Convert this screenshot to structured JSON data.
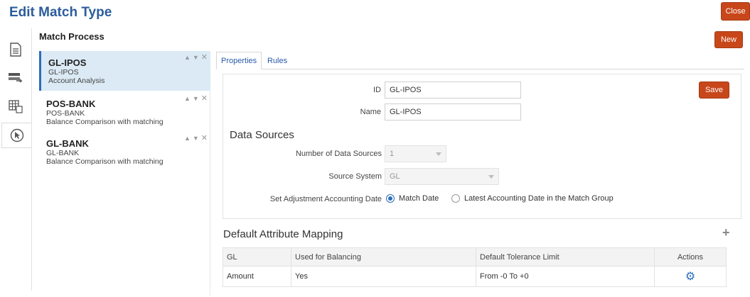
{
  "header": {
    "title": "Edit Match Type",
    "close_label": "Close",
    "new_label": "New"
  },
  "sidebar": {
    "icons": [
      "document-list-icon",
      "transfer-icon",
      "grid-table-icon",
      "cursor-icon"
    ]
  },
  "match_process": {
    "title": "Match Process",
    "items": [
      {
        "name": "GL-IPOS",
        "line1": "GL-IPOS",
        "line2": "Account Analysis",
        "selected": true
      },
      {
        "name": "POS-BANK",
        "line1": "POS-BANK",
        "line2": "Balance Comparison with matching",
        "selected": false
      },
      {
        "name": "GL-BANK",
        "line1": "GL-BANK",
        "line2": "Balance Comparison with matching",
        "selected": false
      }
    ]
  },
  "tabs": [
    {
      "label": "Properties",
      "active": true
    },
    {
      "label": "Rules",
      "active": false
    }
  ],
  "properties": {
    "id_label": "ID",
    "id_value": "GL-IPOS",
    "name_label": "Name",
    "name_value": "GL-IPOS",
    "save_label": "Save"
  },
  "data_sources": {
    "title": "Data Sources",
    "num_label": "Number of Data Sources",
    "num_value": "1",
    "source_label": "Source System",
    "source_value": "GL",
    "adj_label": "Set Adjustment Accounting Date",
    "radio_options": [
      {
        "label": "Match Date",
        "selected": true
      },
      {
        "label": "Latest Accounting Date in the Match Group",
        "selected": false
      }
    ]
  },
  "mapping": {
    "title": "Default Attribute Mapping",
    "columns": [
      "GL",
      "Used for Balancing",
      "Default Tolerance Limit",
      "Actions"
    ],
    "rows": [
      {
        "gl": "Amount",
        "balancing": "Yes",
        "tolerance": "From -0 To +0"
      }
    ]
  },
  "colors": {
    "accent": "#2a6ebb",
    "title_blue": "#2b5d9b",
    "button_orange": "#c8471a",
    "selected_bg": "#dbeaf5"
  }
}
